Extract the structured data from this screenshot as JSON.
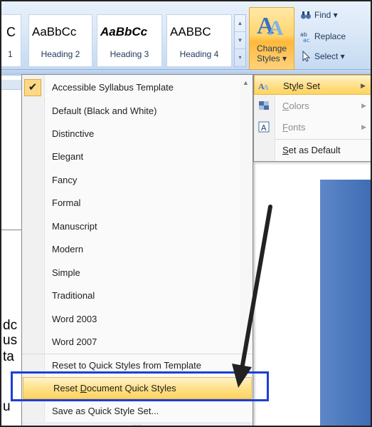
{
  "ribbon": {
    "styles": [
      {
        "sample": "C",
        "caption": "1"
      },
      {
        "sample": "AaBbCc",
        "caption": "Heading 2"
      },
      {
        "sample": "AaBbCc",
        "caption": "Heading 3"
      },
      {
        "sample": "AABBC",
        "caption": "Heading 4"
      }
    ],
    "change_styles": {
      "line1": "Change",
      "line2": "Styles ▾"
    },
    "editing": {
      "find": "Find ▾",
      "replace": "Replace",
      "select": "Select ▾"
    }
  },
  "document": {
    "fragments": [
      "dc",
      "us",
      "ta",
      "u"
    ]
  },
  "menu": {
    "items": [
      {
        "label": "Accessible Syllabus Template",
        "checked": true
      },
      {
        "label": "Default (Black and White)"
      },
      {
        "label": "Distinctive"
      },
      {
        "label": "Elegant"
      },
      {
        "label": "Fancy"
      },
      {
        "label": "Formal"
      },
      {
        "label": "Manuscript"
      },
      {
        "label": "Modern"
      },
      {
        "label": "Simple"
      },
      {
        "label": "Traditional"
      },
      {
        "label": "Word 2003"
      },
      {
        "label": "Word 2007"
      }
    ],
    "actions": {
      "reset_template": "Reset to Quick Styles from Template",
      "reset_document_pre": "Reset ",
      "reset_document_key": "D",
      "reset_document_post": "ocument Quick Styles",
      "save_set": "Save as Quick Style Set..."
    }
  },
  "submenu": {
    "style_set_pre": "St",
    "style_set_key": "y",
    "style_set_post": "le Set",
    "colors_key": "C",
    "colors_post": "olors",
    "fonts_key": "F",
    "fonts_post": "onts",
    "default_key": "S",
    "default_post": "et as Default"
  },
  "colors": {
    "highlight": "#ffd45c",
    "annotation_box": "#1c3fd8",
    "arrow": "#222222"
  }
}
